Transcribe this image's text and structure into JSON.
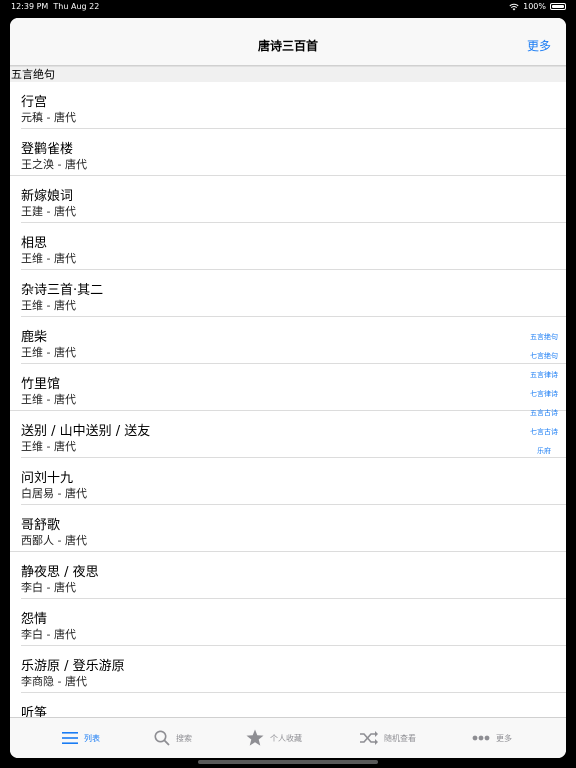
{
  "status": {
    "time": "12:39 PM",
    "date": "Thu Aug 22",
    "battery": "100%"
  },
  "nav": {
    "title": "唐诗三百首",
    "more": "更多"
  },
  "section": "五言绝句",
  "poems": [
    {
      "title": "行宫",
      "author": "元稹 - 唐代"
    },
    {
      "title": "登鹳雀楼",
      "author": "王之涣 - 唐代"
    },
    {
      "title": "新嫁娘词",
      "author": "王建 - 唐代"
    },
    {
      "title": "相思",
      "author": "王维 - 唐代"
    },
    {
      "title": "杂诗三首·其二",
      "author": "王维 - 唐代"
    },
    {
      "title": "鹿柴",
      "author": "王维 - 唐代"
    },
    {
      "title": "竹里馆",
      "author": "王维 - 唐代"
    },
    {
      "title": "送别 / 山中送别 / 送友",
      "author": "王维 - 唐代"
    },
    {
      "title": "问刘十九",
      "author": "白居易 - 唐代"
    },
    {
      "title": "哥舒歌",
      "author": "西鄙人 - 唐代"
    },
    {
      "title": "静夜思 / 夜思",
      "author": "李白 - 唐代"
    },
    {
      "title": "怨情",
      "author": "李白 - 唐代"
    },
    {
      "title": "乐游原 / 登乐游原",
      "author": "李商隐 - 唐代"
    },
    {
      "title": "听筝",
      "author": ""
    }
  ],
  "index": [
    "五言绝句",
    "七言绝句",
    "五言律诗",
    "七言律诗",
    "五言古诗",
    "七言古诗",
    "乐府"
  ],
  "tabs": [
    {
      "label": "列表",
      "icon": "list-icon"
    },
    {
      "label": "搜索",
      "icon": "search-icon"
    },
    {
      "label": "个人收藏",
      "icon": "star-icon"
    },
    {
      "label": "随机查看",
      "icon": "shuffle-icon"
    },
    {
      "label": "更多",
      "icon": "more-icon"
    }
  ],
  "colors": {
    "accent": "#1a7cf4",
    "inactive": "#8e8e93"
  }
}
